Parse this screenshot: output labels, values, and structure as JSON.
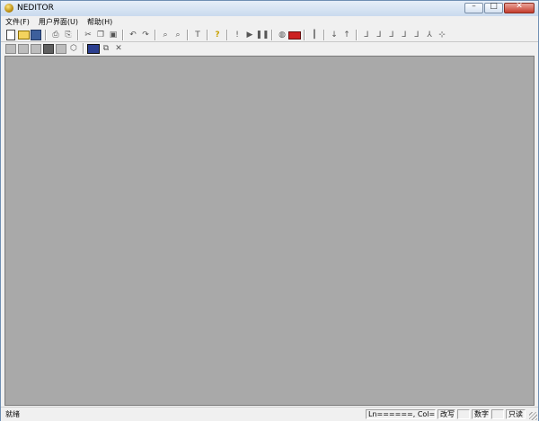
{
  "window": {
    "title": "NEDITOR",
    "minimize": "–",
    "maximize": "□",
    "close": "✕"
  },
  "menu": [
    {
      "label": "文件(F)"
    },
    {
      "label": "用户界面(U)"
    },
    {
      "label": "帮助(H)"
    }
  ],
  "toolbar1": [
    {
      "name": "new-file-icon",
      "glyph": "",
      "cls": "i-doc"
    },
    {
      "name": "open-folder-icon",
      "glyph": "",
      "cls": "i-folder"
    },
    {
      "name": "save-icon",
      "glyph": "",
      "cls": "i-disk"
    },
    {
      "sep": true
    },
    {
      "name": "print-icon",
      "glyph": "⎙"
    },
    {
      "name": "print-preview-icon",
      "glyph": "⎘"
    },
    {
      "sep": true
    },
    {
      "name": "cut-icon",
      "glyph": "✂"
    },
    {
      "name": "copy-icon",
      "glyph": "❐"
    },
    {
      "name": "paste-icon",
      "glyph": "▣"
    },
    {
      "sep": true
    },
    {
      "name": "undo-icon",
      "glyph": "↶"
    },
    {
      "name": "redo-icon",
      "glyph": "↷"
    },
    {
      "sep": true
    },
    {
      "name": "find-icon",
      "glyph": "⌕"
    },
    {
      "name": "find-next-icon",
      "glyph": "⌕"
    },
    {
      "sep": true
    },
    {
      "name": "text-icon",
      "glyph": "T"
    },
    {
      "sep": true
    },
    {
      "name": "help-icon",
      "glyph": "?",
      "cls": "i-yellow"
    },
    {
      "sep": true
    },
    {
      "name": "run-icon",
      "glyph": "!"
    },
    {
      "name": "play-icon",
      "glyph": "▶"
    },
    {
      "name": "pause-icon",
      "glyph": "❚❚"
    },
    {
      "sep": true
    },
    {
      "name": "component-icon",
      "glyph": "◍"
    },
    {
      "name": "record-icon",
      "glyph": "",
      "cls": "i-red"
    },
    {
      "sep": true
    },
    {
      "name": "vertical-bar-icon",
      "glyph": "┃"
    },
    {
      "sep": true
    },
    {
      "name": "step-in-icon",
      "glyph": "↓"
    },
    {
      "name": "step-out-icon",
      "glyph": "↑"
    },
    {
      "sep": true
    },
    {
      "name": "branch-1-icon",
      "glyph": "⅃"
    },
    {
      "name": "branch-2-icon",
      "glyph": "⅃"
    },
    {
      "name": "branch-3-icon",
      "glyph": "⅃"
    },
    {
      "name": "branch-4-icon",
      "glyph": "⅃"
    },
    {
      "name": "branch-5-icon",
      "glyph": "⅃"
    },
    {
      "name": "branch-6-icon",
      "glyph": "⅄"
    },
    {
      "name": "branch-7-icon",
      "glyph": "⊹"
    }
  ],
  "toolbar2": [
    {
      "name": "frame-icon",
      "glyph": "",
      "cls": "i-gray"
    },
    {
      "name": "panel-icon",
      "glyph": "",
      "cls": "i-gray"
    },
    {
      "name": "image-icon",
      "glyph": "",
      "cls": "i-gray"
    },
    {
      "name": "block-icon",
      "glyph": "",
      "cls": "i-dark"
    },
    {
      "name": "window-icon",
      "glyph": "",
      "cls": "i-gray"
    },
    {
      "name": "shape-icon",
      "glyph": "⬡"
    },
    {
      "sep": true
    },
    {
      "name": "form-icon",
      "glyph": "",
      "cls": "i-blue"
    },
    {
      "name": "duplicate-icon",
      "glyph": "⧉"
    },
    {
      "name": "delete-icon",
      "glyph": "✕"
    }
  ],
  "status": {
    "text": "就绪",
    "position": "Ln======, Col===",
    "overwrite": "改写",
    "numlock": "数字",
    "readonly": "只读"
  }
}
